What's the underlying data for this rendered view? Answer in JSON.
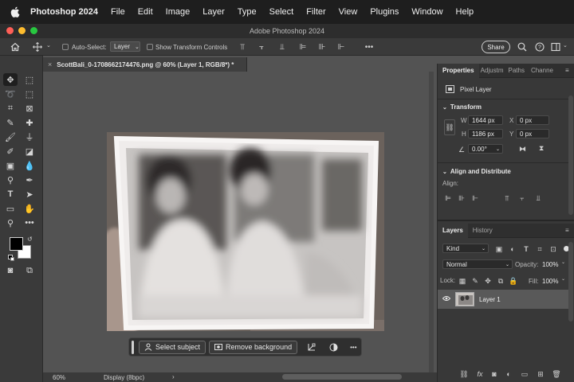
{
  "menubar": {
    "app": "Photoshop 2024",
    "items": [
      "File",
      "Edit",
      "Image",
      "Layer",
      "Type",
      "Select",
      "Filter",
      "View",
      "Plugins",
      "Window",
      "Help"
    ]
  },
  "window": {
    "title": "Adobe Photoshop 2024"
  },
  "options_bar": {
    "auto_select_label": "Auto-Select:",
    "auto_select_value": "Layer",
    "show_transform_label": "Show Transform Controls",
    "share_label": "Share"
  },
  "document": {
    "tab_title": "ScottBali_0-1708662174476.png @ 60% (Layer 1, RGB/8*) *",
    "close_glyph": "×"
  },
  "context_bar": {
    "select_subject": "Select subject",
    "remove_background": "Remove background",
    "more": "•••"
  },
  "status": {
    "zoom": "60%",
    "display": "Display (8bpc)"
  },
  "properties": {
    "tabs": [
      "Properties",
      "Adjustm",
      "Paths",
      "Channe"
    ],
    "kind": "Pixel Layer",
    "transform_title": "Transform",
    "w_label": "W",
    "w_value": "1644 px",
    "h_label": "H",
    "h_value": "1186 px",
    "x_label": "X",
    "x_value": "0 px",
    "y_label": "Y",
    "y_value": "0 px",
    "angle_value": "0.00°",
    "align_title": "Align and Distribute",
    "align_label": "Align:"
  },
  "layers": {
    "tabs": [
      "Layers",
      "History"
    ],
    "filter_kind": "Kind",
    "blend_mode": "Normal",
    "opacity_label": "Opacity:",
    "opacity_value": "100%",
    "lock_label": "Lock:",
    "fill_label": "Fill:",
    "fill_value": "100%",
    "items": [
      {
        "name": "Layer 1"
      }
    ]
  },
  "colors": {
    "menubar_bg": "#1e1e1e",
    "panel_bg": "#383838",
    "canvas_bg": "#535353",
    "close_red": "#ff5f57",
    "minimize_yellow": "#febc2e",
    "maximize_green": "#28c840",
    "foreground_swatch": "#000000",
    "background_swatch": "#ffffff"
  }
}
